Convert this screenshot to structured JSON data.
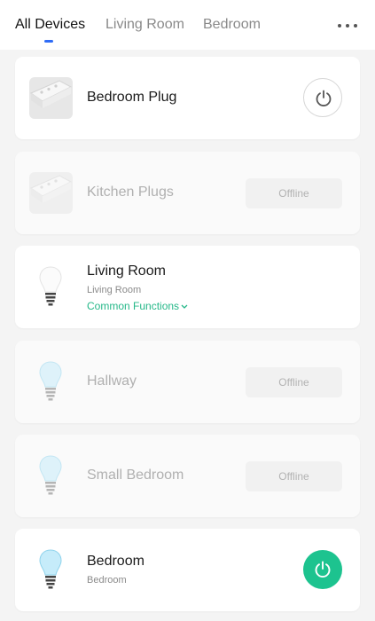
{
  "tabs": [
    {
      "label": "All Devices",
      "active": true
    },
    {
      "label": "Living Room",
      "active": false
    },
    {
      "label": "Bedroom",
      "active": false
    }
  ],
  "more_icon": "more-horizontal-icon",
  "colors": {
    "accent_blue": "#2f6cf6",
    "power_on_green": "#1dc38f",
    "link_green": "#26b889"
  },
  "devices": [
    {
      "name": "Bedroom Plug",
      "type": "plug",
      "status": "online",
      "power": "off",
      "icon": "power-strip-icon"
    },
    {
      "name": "Kitchen Plugs",
      "type": "plug",
      "status": "offline",
      "badge": "Offline",
      "icon": "power-strip-icon"
    },
    {
      "name": "Living Room",
      "type": "bulb",
      "status": "online",
      "room": "Living Room",
      "link": "Common Functions",
      "icon": "light-bulb-icon"
    },
    {
      "name": "Hallway",
      "type": "bulb",
      "status": "offline",
      "badge": "Offline",
      "icon": "light-bulb-icon"
    },
    {
      "name": "Small Bedroom",
      "type": "bulb",
      "status": "offline",
      "badge": "Offline",
      "icon": "light-bulb-icon"
    },
    {
      "name": "Bedroom",
      "type": "bulb",
      "status": "online",
      "room": "Bedroom",
      "power": "on",
      "icon": "light-bulb-icon"
    }
  ]
}
